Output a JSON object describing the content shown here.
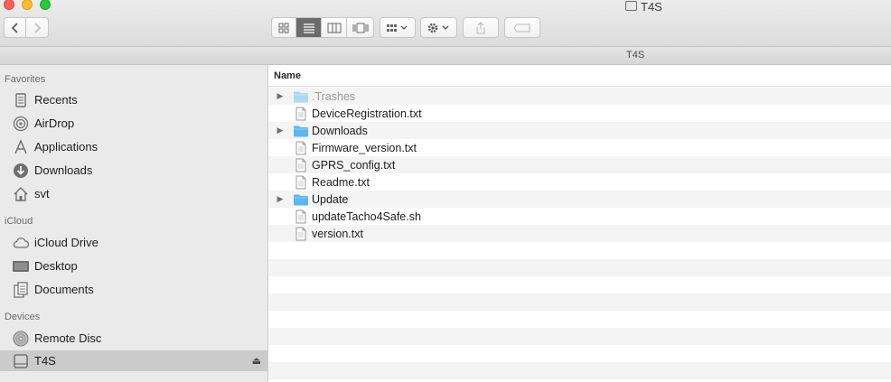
{
  "window": {
    "title": "T4S"
  },
  "toolbar": {
    "back_icon": "chevron-left-icon",
    "forward_icon": "chevron-right-icon",
    "views": [
      "icon-view",
      "list-view",
      "column-view",
      "gallery-view"
    ],
    "active_view": "list-view"
  },
  "pathbar": {
    "current": "T4S"
  },
  "sidebar": {
    "favorites_header": "Favorites",
    "favorites": [
      {
        "label": "Recents",
        "icon": "recents-icon"
      },
      {
        "label": "AirDrop",
        "icon": "airdrop-icon"
      },
      {
        "label": "Applications",
        "icon": "applications-icon"
      },
      {
        "label": "Downloads",
        "icon": "downloads-icon"
      },
      {
        "label": "svt",
        "icon": "home-icon"
      }
    ],
    "icloud_header": "iCloud",
    "icloud": [
      {
        "label": "iCloud Drive",
        "icon": "cloud-icon"
      },
      {
        "label": "Desktop",
        "icon": "desktop-icon"
      },
      {
        "label": "Documents",
        "icon": "documents-icon"
      }
    ],
    "devices_header": "Devices",
    "devices": [
      {
        "label": "Remote Disc",
        "icon": "disc-icon"
      },
      {
        "label": "T4S",
        "icon": "drive-icon"
      }
    ],
    "eject_glyph": "⏏"
  },
  "list": {
    "column_name": "Name",
    "items": [
      {
        "name": ".Trashes",
        "type": "folder",
        "expandable": true
      },
      {
        "name": "DeviceRegistration.txt",
        "type": "file",
        "expandable": false
      },
      {
        "name": "Downloads",
        "type": "folder",
        "expandable": true
      },
      {
        "name": "Firmware_version.txt",
        "type": "file",
        "expandable": false
      },
      {
        "name": "GPRS_config.txt",
        "type": "file",
        "expandable": false
      },
      {
        "name": "Readme.txt",
        "type": "file",
        "expandable": false
      },
      {
        "name": "Update",
        "type": "folder",
        "expandable": true
      },
      {
        "name": "updateTacho4Safe.sh",
        "type": "file",
        "expandable": false
      },
      {
        "name": "version.txt",
        "type": "file",
        "expandable": false
      }
    ]
  },
  "colors": {
    "folder": "#5db7ef",
    "selected_sidebar": "#cbcbcb"
  }
}
